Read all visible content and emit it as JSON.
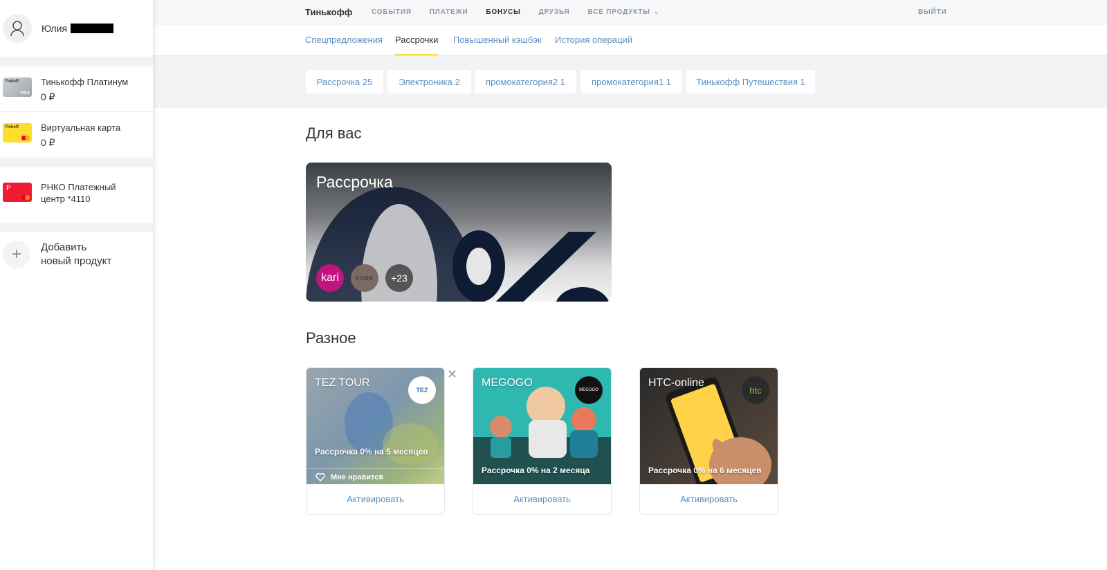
{
  "sidebar": {
    "user_name": "Юлия",
    "products": [
      {
        "name": "Тинькофф Платинум",
        "balance": "0 ₽",
        "card_text": "Tinkoff",
        "card_brand": "VISA"
      },
      {
        "name": "Виртуальная карта",
        "balance": "0 ₽",
        "card_text": "Tinkoff"
      },
      {
        "name_line1": "РНКО Платежный",
        "name_line2": "центр *4110",
        "card_text": "P"
      }
    ],
    "add_line1": "Добавить",
    "add_line2": "новый продукт"
  },
  "topnav": {
    "brand": "Тинькофф",
    "items": [
      "СОБЫТИЯ",
      "ПЛАТЕЖИ",
      "БОНУСЫ",
      "ДРУЗЬЯ",
      "ВСЕ ПРОДУКТЫ"
    ],
    "active": "БОНУСЫ",
    "logout": "ВЫЙТИ"
  },
  "subtabs": [
    "Спецпредложения",
    "Рассрочки",
    "Повышенный кэшбэк",
    "История операций"
  ],
  "chips": [
    "Рассрочка 25",
    "Электроника 2",
    "промокатегория2 1",
    "промокатегория1 1",
    "Тинькофф Путешествия 1"
  ],
  "for_you": {
    "heading": "Для вас",
    "card_title": "Рассрочка",
    "logos": [
      "kari",
      "BORK",
      "+23"
    ]
  },
  "misc": {
    "heading": "Разное",
    "offers": [
      {
        "title": "TEZ TOUR",
        "logo": "TEZ",
        "desc": "Рассрочка 0% на 5 месяцев",
        "like": "Мне нравится",
        "button": "Активировать"
      },
      {
        "title": "MEGOGO",
        "logo": "MEGOGO",
        "desc": "Рассрочка 0% на 2 месяца",
        "button": "Активировать"
      },
      {
        "title": "HTC-online",
        "logo": "htc",
        "desc": "Рассрочка 0% на 6 месяцев",
        "button": "Активировать"
      }
    ]
  },
  "colors": {
    "accent": "#ffdd2d",
    "link": "#5a8fbf",
    "brand_red": "#ee1c34"
  }
}
